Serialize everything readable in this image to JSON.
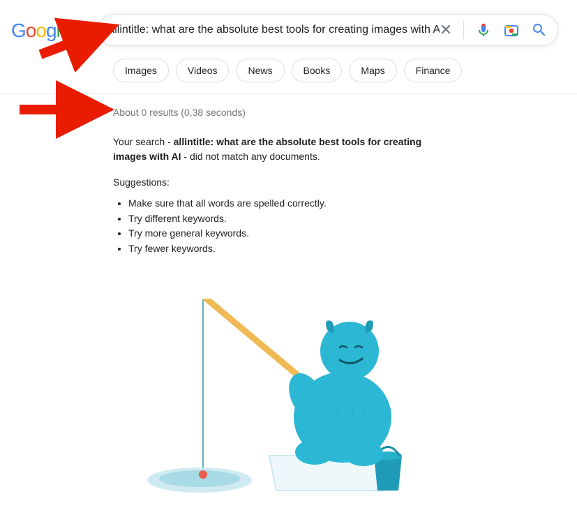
{
  "logo": {
    "text": "Google"
  },
  "search": {
    "query": "allintitle: what are the absolute best tools for creating images with AI",
    "clear_label": "Clear"
  },
  "tabs": [
    {
      "label": "Images"
    },
    {
      "label": "Videos"
    },
    {
      "label": "News"
    },
    {
      "label": "Books"
    },
    {
      "label": "Maps"
    },
    {
      "label": "Finance"
    }
  ],
  "results": {
    "stats": "About 0 results (0,38 seconds)",
    "no_match_prefix": "Your search - ",
    "no_match_query": "allintitle: what are the absolute best tools for creating images with AI",
    "no_match_suffix": " - did not match any documents.",
    "suggestions_title": "Suggestions:",
    "suggestions": [
      "Make sure that all words are spelled correctly.",
      "Try different keywords.",
      "Try more general keywords.",
      "Try fewer keywords."
    ]
  }
}
